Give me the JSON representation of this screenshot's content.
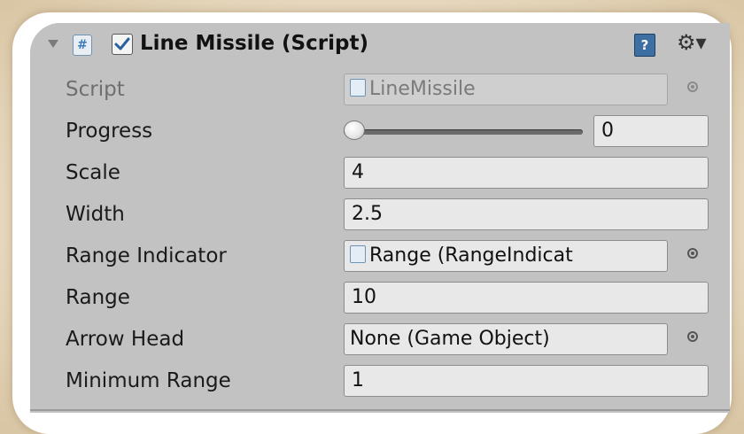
{
  "component": {
    "title": "Line Missile (Script)",
    "enabled": true,
    "script_icon_glyph": "#",
    "help_glyph": "?",
    "gear_glyph": "⚙▾"
  },
  "fields": {
    "script": {
      "label": "Script",
      "value": "LineMissile"
    },
    "progress": {
      "label": "Progress",
      "value": "0",
      "slider_fraction": 0
    },
    "scale": {
      "label": "Scale",
      "value": "4"
    },
    "width": {
      "label": "Width",
      "value": "2.5"
    },
    "range_indicator": {
      "label": "Range Indicator",
      "value": "Range (RangeIndicat"
    },
    "range": {
      "label": "Range",
      "value": "10"
    },
    "arrow_head": {
      "label": "Arrow Head",
      "value": "None (Game Object)"
    },
    "minimum_range": {
      "label": "Minimum Range",
      "value": "1"
    }
  },
  "icons": {
    "foldout": "triangle-down-icon",
    "script": "csharp-script-icon",
    "help": "help-book-icon",
    "gear": "gear-icon",
    "picker": "object-picker-icon"
  },
  "colors": {
    "panel_bg": "#c2c2c2",
    "field_bg": "#e8e8e8",
    "frame": "#ffffff",
    "background": "#e6d7bd",
    "help_icon": "#3e6fa3"
  }
}
